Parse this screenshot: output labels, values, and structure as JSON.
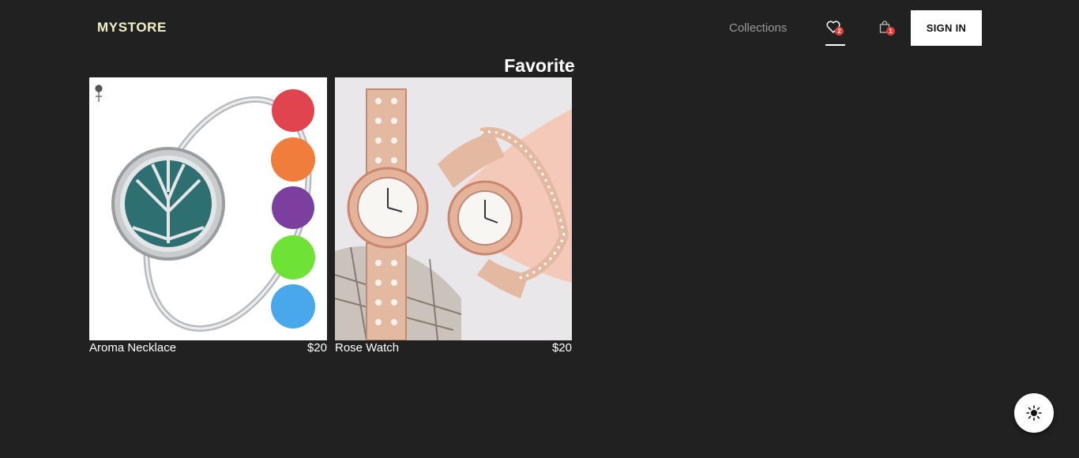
{
  "header": {
    "logo": "MYSTORE",
    "nav": {
      "collections": "Collections"
    },
    "favorites_count": "2",
    "cart_count": "1",
    "signin_label": "SIGN IN"
  },
  "page": {
    "title": "Favorite"
  },
  "products": [
    {
      "name": "Aroma Necklace",
      "price": "$20",
      "image": "aroma-necklace-bracelet"
    },
    {
      "name": "Rose Watch",
      "price": "$20",
      "image": "rose-gold-watches"
    }
  ],
  "icons": {
    "favorites": "heart-icon",
    "cart": "shopping-bag-icon",
    "theme": "sun-icon"
  },
  "colors": {
    "background": "#212121",
    "logo": "#f3efc6",
    "badge": "#e53935",
    "nav_muted": "#9a9a9a"
  }
}
